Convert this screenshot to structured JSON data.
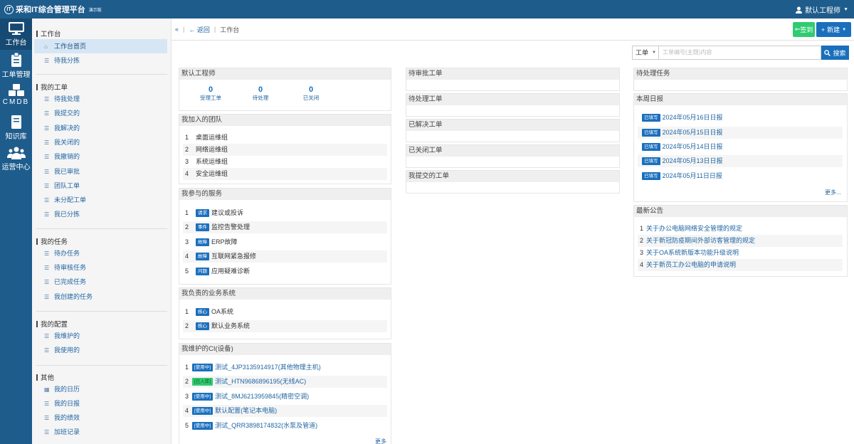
{
  "app": {
    "title": "采和IT综合管理平台",
    "edition": "演示版",
    "logo": "IT",
    "user_label": "默认工程师"
  },
  "iconbar": [
    {
      "label": "工作台",
      "icon": "monitor-icon"
    },
    {
      "label": "工单管理",
      "icon": "clipboard-icon"
    },
    {
      "label": "CMDB",
      "icon": "cubes-icon"
    },
    {
      "label": "知识库",
      "icon": "book-icon"
    },
    {
      "label": "运营中心",
      "icon": "users-icon"
    }
  ],
  "menu": {
    "workbench": {
      "title": "工作台",
      "items": [
        "工作台首页",
        "待我分拣"
      ]
    },
    "my_tickets": {
      "title": "我的工单",
      "items": [
        "待我处理",
        "我提交的",
        "我解决的",
        "我关闭的",
        "我撤销的",
        "我已审批",
        "团队工单",
        "未分配工单",
        "我已分拣"
      ]
    },
    "my_tasks": {
      "title": "我的任务",
      "items": [
        "待办任务",
        "待审核任务",
        "已完成任务",
        "我创建的任务"
      ]
    },
    "my_config": {
      "title": "我的配置",
      "items": [
        "我维护的",
        "我使用的"
      ]
    },
    "other": {
      "title": "其他",
      "items": [
        "我的日历",
        "我的日报",
        "我的绩效",
        "加班记录"
      ]
    }
  },
  "breadcrumb": {
    "back": "返回",
    "current": "工作台"
  },
  "toolbar": {
    "sign_in": "签到",
    "new": "新建"
  },
  "search": {
    "type": "工单",
    "placeholder": "工单编号(主题)内容",
    "button": "搜索"
  },
  "profile": {
    "name": "默认工程师",
    "stats": [
      {
        "value": "0",
        "label": "受理工单"
      },
      {
        "value": "0",
        "label": "待处理"
      },
      {
        "value": "0",
        "label": "已关闭"
      }
    ]
  },
  "teams": {
    "title": "我加入的团队",
    "rows": [
      {
        "no": "1",
        "name": "桌面运维组"
      },
      {
        "no": "2",
        "name": "网络运维组"
      },
      {
        "no": "3",
        "name": "系统运维组"
      },
      {
        "no": "4",
        "name": "安全运维组"
      }
    ]
  },
  "services": {
    "title": "我参与的服务",
    "rows": [
      {
        "no": "1",
        "tag": "请求",
        "name": "建议或投诉"
      },
      {
        "no": "2",
        "tag": "事件",
        "name": "监控告警处理"
      },
      {
        "no": "3",
        "tag": "故障",
        "name": "ERP故障"
      },
      {
        "no": "4",
        "tag": "故障",
        "name": "互联网紧急报修"
      },
      {
        "no": "5",
        "tag": "问题",
        "name": "应用疑难诊断"
      }
    ]
  },
  "systems": {
    "title": "我负责的业务系统",
    "rows": [
      {
        "no": "1",
        "tag": "核心",
        "name": "OA系统"
      },
      {
        "no": "2",
        "tag": "核心",
        "name": "默认业务系统"
      }
    ]
  },
  "cis": {
    "title": "我维护的CI(设备)",
    "more": "更多",
    "rows": [
      {
        "no": "1",
        "tag": "[使用中]",
        "name": "测试_4JP3135914917(其他物理主机)"
      },
      {
        "no": "2",
        "tag": "[已入库]",
        "name": "测试_HTN9686896195(无线AC)"
      },
      {
        "no": "3",
        "tag": "[使用中]",
        "name": "测试_8MJ6213959845(精密空调)"
      },
      {
        "no": "4",
        "tag": "[使用中]",
        "name": "默认配置(笔记本电脑)"
      },
      {
        "no": "5",
        "tag": "[使用中]",
        "name": "测试_QRR3898174832(水泵及管道)"
      }
    ]
  },
  "ticket_panels": [
    "待审批工单",
    "待处理工单",
    "已解决工单",
    "已关闭工单",
    "我提交的工单"
  ],
  "pending_tasks": {
    "title": "待处理任务"
  },
  "weekly": {
    "title": "本周日报",
    "more": "更多...",
    "rows": [
      {
        "tag": "已填写",
        "text": "2024年05月16日日报"
      },
      {
        "tag": "已填写",
        "text": "2024年05月15日日报"
      },
      {
        "tag": "已填写",
        "text": "2024年05月14日日报"
      },
      {
        "tag": "已填写",
        "text": "2024年05月13日日报"
      },
      {
        "tag": "已填写",
        "text": "2024年05月11日日报"
      }
    ]
  },
  "notices": {
    "title": "最新公告",
    "rows": [
      {
        "no": "1",
        "text": "关于办公电脑网络安全管理的规定"
      },
      {
        "no": "2",
        "text": "关于新冠防疫期间外部访客管理的规定"
      },
      {
        "no": "3",
        "text": "关于OA系统新版本功能升级说明"
      },
      {
        "no": "4",
        "text": "关于新员工办公电脑的申请说明"
      }
    ]
  }
}
